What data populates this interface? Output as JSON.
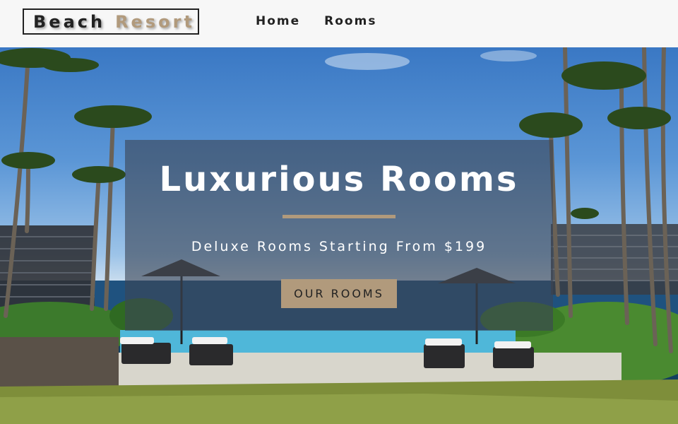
{
  "navbar": {
    "logo_word1": "Beach",
    "logo_word2": "Resort",
    "links": [
      {
        "label": "Home"
      },
      {
        "label": "Rooms"
      }
    ]
  },
  "hero": {
    "title": "Luxurious Rooms",
    "subtitle": "Deluxe Rooms Starting From $199",
    "button_label": "OUR ROOMS"
  },
  "colors": {
    "accent": "#b19a7c",
    "navbar_bg": "#f7f7f7",
    "text_dark": "#222222",
    "banner_overlay": "rgba(60,70,85,0.62)"
  }
}
